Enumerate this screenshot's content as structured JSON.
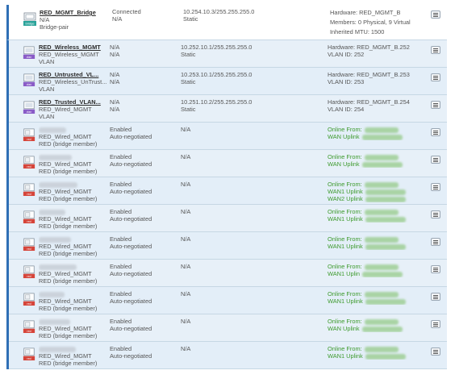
{
  "rows": [
    {
      "type": "bridge",
      "icon": "bridge-icon",
      "name": "RED_MGMT_Bridge",
      "line2": "N/A",
      "line3": "Bridge-pair",
      "status1": "Connected",
      "status2": "N/A",
      "ip1": "10.254.10.3/255.255.255.0",
      "ip2": "Static",
      "info": [
        "Hardware: RED_MGMT_B",
        "Members: 0 Physical, 9 Virtual",
        "Inherited MTU: 1500"
      ]
    },
    {
      "type": "vlan",
      "icon": "vlan-icon",
      "name": "RED_Wireless_MGMT",
      "line2": "RED_Wireless_MGMT",
      "line3": "VLAN",
      "status1": "N/A",
      "status2": "N/A",
      "ip1": "10.252.10.1/255.255.255.0",
      "ip2": "Static",
      "info": [
        "Hardware: RED_MGMT_B.252",
        "VLAN ID: 252"
      ]
    },
    {
      "type": "vlan",
      "icon": "vlan-icon",
      "name": "RED_Untrusted_VL...",
      "line2": "RED_Wireless_UnTrust...",
      "line3": "VLAN",
      "status1": "N/A",
      "status2": "N/A",
      "ip1": "10.253.10.1/255.255.255.0",
      "ip2": "Static",
      "info": [
        "Hardware: RED_MGMT_B.253",
        "VLAN ID: 253"
      ]
    },
    {
      "type": "vlan",
      "icon": "vlan-icon",
      "name": "RED_Trusted_VLAN...",
      "line2": "RED_Wired_MGMT",
      "line3": "VLAN",
      "status1": "N/A",
      "status2": "N/A",
      "ip1": "10.251.10.2/255.255.255.0",
      "ip2": "Static",
      "info": [
        "Hardware: RED_MGMT_B.254",
        "VLAN ID: 254"
      ]
    },
    {
      "type": "red",
      "icon": "red-device-icon",
      "line2": "RED_Wired_MGMT",
      "line3": "RED (bridge member)",
      "status1": "Enabled",
      "status2": "Auto-negotiated",
      "ip1": "N/A",
      "online": [
        "Online From:",
        "WAN Uplink"
      ]
    },
    {
      "type": "red",
      "icon": "red-device-icon",
      "line2": "RED_Wired_MGMT",
      "line3": "RED (bridge member)",
      "status1": "Enabled",
      "status2": "Auto-negotiated",
      "ip1": "N/A",
      "online": [
        "Online From:",
        "WAN Uplink"
      ]
    },
    {
      "type": "red",
      "icon": "red-device-icon",
      "line2": "RED_Wired_MGMT",
      "line3": "RED (bridge member)",
      "status1": "Enabled",
      "status2": "Auto-negotiated",
      "ip1": "N/A",
      "online": [
        "Online From:",
        "WAN1 Uplink",
        "WAN2 Uplink"
      ]
    },
    {
      "type": "red",
      "icon": "red-device-icon",
      "line2": "RED_Wired_MGMT",
      "line3": "RED (bridge member)",
      "status1": "Enabled",
      "status2": "Auto-negotiated",
      "ip1": "N/A",
      "online": [
        "Online From:",
        "WAN1 Uplink"
      ]
    },
    {
      "type": "red",
      "icon": "red-device-icon",
      "line2": "RED_Wired_MGMT",
      "line3": "RED (bridge member)",
      "status1": "Enabled",
      "status2": "Auto-negotiated",
      "ip1": "N/A",
      "online": [
        "Online From:",
        "WAN1 Uplink"
      ]
    },
    {
      "type": "red",
      "icon": "red-device-icon",
      "line2": "RED_Wired_MGMT",
      "line3": "RED (bridge member)",
      "status1": "Enabled",
      "status2": "Auto-negotiated",
      "ip1": "N/A",
      "online": [
        "Online From:",
        "WAN1 Uplin"
      ]
    },
    {
      "type": "red",
      "icon": "red-device-icon",
      "line2": "RED_Wired_MGMT",
      "line3": "RED (bridge member)",
      "status1": "Enabled",
      "status2": "Auto-negotiated",
      "ip1": "N/A",
      "online": [
        "Online From:",
        "WAN1 Uplink"
      ]
    },
    {
      "type": "red",
      "icon": "red-device-icon",
      "line2": "RED_Wired_MGMT",
      "line3": "RED (bridge member)",
      "status1": "Enabled",
      "status2": "Auto-negotiated",
      "ip1": "N/A",
      "online": [
        "Online From:",
        "WAN Uplink"
      ]
    },
    {
      "type": "red",
      "icon": "red-device-icon",
      "line2": "RED_Wired_MGMT",
      "line3": "RED (bridge member)",
      "status1": "Enabled",
      "status2": "Auto-negotiated",
      "ip1": "N/A",
      "online": [
        "Online From:",
        "WAN1 Uplink"
      ]
    }
  ],
  "icon_labels": {
    "bridge": "bridge",
    "vlan": "vlan",
    "red": "red"
  },
  "colors": {
    "accent": "#2f6fb5",
    "row_bg": "#e3eef8",
    "online": "#3d9a2d",
    "vlan_icon": "#8a5cc7",
    "red_icon": "#d6453a"
  }
}
